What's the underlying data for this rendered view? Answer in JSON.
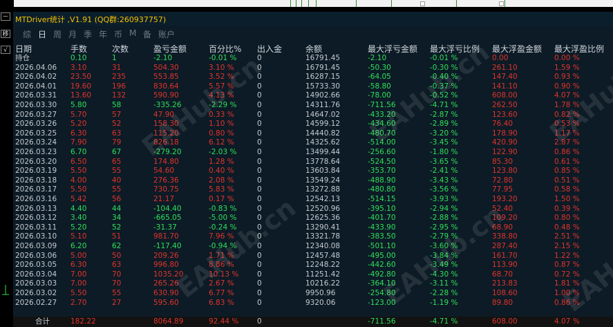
{
  "window_title": "MTDriver统计 ,V1.91 (QQ群:260937757)",
  "side_buttons": [
    "－",
    "移",
    "√"
  ],
  "tabs": [
    {
      "label": "综",
      "active": false
    },
    {
      "label": "日",
      "active": true
    },
    {
      "label": "周",
      "active": false
    },
    {
      "label": "月",
      "active": false
    },
    {
      "label": "季",
      "active": false
    },
    {
      "label": "年",
      "active": false
    },
    {
      "label": "币",
      "active": false
    },
    {
      "label": "M",
      "active": false
    },
    {
      "label": "备",
      "active": false
    },
    {
      "label": "账户",
      "active": false
    }
  ],
  "columns": [
    "日期",
    "手数",
    "次数",
    "盈亏金额",
    "百分比%",
    "出入金",
    "余额",
    "最大浮亏金额",
    "最大浮亏比例",
    "最大浮盈金额",
    "最大浮盈比例"
  ],
  "rows": [
    {
      "date": "持仓",
      "lots": "0.10",
      "count": "1",
      "pnl": "-2.10",
      "pct": "-0.01 %",
      "io": "0",
      "bal": "16791.45",
      "mfl": "-2.10",
      "mflp": "-0.01 %",
      "mfp": "0.00",
      "mfpp": "0.00 %",
      "color": "green"
    },
    {
      "date": "2026.04.06",
      "lots": "3.10",
      "count": "31",
      "pnl": "504.30",
      "pct": "3.10 %",
      "io": "0",
      "bal": "16791.45",
      "mfl": "-50.30",
      "mflp": "-0.30 %",
      "mfp": "261.10",
      "mfpp": "1.59 %",
      "color": "red"
    },
    {
      "date": "2026.04.02",
      "lots": "23.50",
      "count": "235",
      "pnl": "553.85",
      "pct": "3.52 %",
      "io": "0",
      "bal": "16287.15",
      "mfl": "-64.05",
      "mflp": "-0.40 %",
      "mfp": "147.40",
      "mfpp": "0.93 %",
      "color": "red"
    },
    {
      "date": "2026.04.01",
      "lots": "19.60",
      "count": "196",
      "pnl": "830.64",
      "pct": "5.57 %",
      "io": "0",
      "bal": "15733.30",
      "mfl": "-58.80",
      "mflp": "-0.37 %",
      "mfp": "141.10",
      "mfpp": "0.90 %",
      "color": "red"
    },
    {
      "date": "2026.03.31",
      "lots": "13.60",
      "count": "132",
      "pnl": "590.90",
      "pct": "4.13 %",
      "io": "0",
      "bal": "14902.66",
      "mfl": "-78.00",
      "mflp": "-0.52 %",
      "mfp": "608.00",
      "mfpp": "4.07 %",
      "color": "red"
    },
    {
      "date": "2026.03.30",
      "lots": "5.80",
      "count": "58",
      "pnl": "-335.26",
      "pct": "-2.29 %",
      "io": "0",
      "bal": "14311.76",
      "mfl": "-711.56",
      "mflp": "-4.71 %",
      "mfp": "262.50",
      "mfpp": "1.78 %",
      "color": "green"
    },
    {
      "date": "2026.03.27",
      "lots": "5.70",
      "count": "57",
      "pnl": "47.90",
      "pct": "0.33 %",
      "io": "0",
      "bal": "14647.02",
      "mfl": "-433.20",
      "mflp": "-2.87 %",
      "mfp": "123.60",
      "mfpp": "0.82 %",
      "color": "red"
    },
    {
      "date": "2026.03.26",
      "lots": "5.20",
      "count": "52",
      "pnl": "158.30",
      "pct": "1.10 %",
      "io": "0",
      "bal": "14599.12",
      "mfl": "-434.60",
      "mflp": "-2.89 %",
      "mfp": "76.40",
      "mfpp": "0.53 %",
      "color": "red"
    },
    {
      "date": "2026.03.25",
      "lots": "6.30",
      "count": "63",
      "pnl": "115.20",
      "pct": "0.80 %",
      "io": "0",
      "bal": "14440.82",
      "mfl": "-480.70",
      "mflp": "-3.20 %",
      "mfp": "178.90",
      "mfpp": "1.17 %",
      "color": "red"
    },
    {
      "date": "2026.03.24",
      "lots": "7.90",
      "count": "79",
      "pnl": "826.18",
      "pct": "6.12 %",
      "io": "0",
      "bal": "14325.62",
      "mfl": "-514.00",
      "mflp": "-3.45 %",
      "mfp": "420.90",
      "mfpp": "2.87 %",
      "color": "red"
    },
    {
      "date": "2026.03.23",
      "lots": "6.70",
      "count": "67",
      "pnl": "-279.20",
      "pct": "-2.03 %",
      "io": "0",
      "bal": "13499.44",
      "mfl": "-256.60",
      "mflp": "-1.80 %",
      "mfp": "122.90",
      "mfpp": "0.86 %",
      "color": "green"
    },
    {
      "date": "2026.03.20",
      "lots": "6.50",
      "count": "65",
      "pnl": "174.80",
      "pct": "1.28 %",
      "io": "0",
      "bal": "13778.64",
      "mfl": "-524.50",
      "mflp": "-3.65 %",
      "mfp": "85.30",
      "mfpp": "0.61 %",
      "color": "red"
    },
    {
      "date": "2026.03.19",
      "lots": "5.50",
      "count": "55",
      "pnl": "54.60",
      "pct": "0.40 %",
      "io": "0",
      "bal": "13603.84",
      "mfl": "-353.70",
      "mflp": "-2.41 %",
      "mfp": "123.80",
      "mfpp": "0.85 %",
      "color": "red"
    },
    {
      "date": "2026.03.18",
      "lots": "4.00",
      "count": "40",
      "pnl": "276.36",
      "pct": "2.08 %",
      "io": "0",
      "bal": "13549.24",
      "mfl": "-488.90",
      "mflp": "-3.43 %",
      "mfp": "72.80",
      "mfpp": "0.51 %",
      "color": "red"
    },
    {
      "date": "2026.03.17",
      "lots": "5.50",
      "count": "55",
      "pnl": "730.75",
      "pct": "5.83 %",
      "io": "0",
      "bal": "13272.88",
      "mfl": "-480.80",
      "mflp": "-3.56 %",
      "mfp": "77.95",
      "mfpp": "0.58 %",
      "color": "red"
    },
    {
      "date": "2026.03.16",
      "lots": "5.42",
      "count": "56",
      "pnl": "21.17",
      "pct": "0.17 %",
      "io": "0",
      "bal": "12542.13",
      "mfl": "-514.15",
      "mflp": "-3.93 %",
      "mfp": "193.20",
      "mfpp": "1.50 %",
      "color": "red"
    },
    {
      "date": "2026.03.13",
      "lots": "4.40",
      "count": "44",
      "pnl": "-104.40",
      "pct": "-0.83 %",
      "io": "0",
      "bal": "12520.96",
      "mfl": "-395.10",
      "mflp": "-2.94 %",
      "mfp": "52.40",
      "mfpp": "0.39 %",
      "color": "green"
    },
    {
      "date": "2026.03.12",
      "lots": "3.40",
      "count": "34",
      "pnl": "-665.05",
      "pct": "-5.00 %",
      "io": "0",
      "bal": "12625.36",
      "mfl": "-401.70",
      "mflp": "-2.88 %",
      "mfp": "109.20",
      "mfpp": "0.80 %",
      "color": "green"
    },
    {
      "date": "2026.03.11",
      "lots": "5.20",
      "count": "52",
      "pnl": "-31.37",
      "pct": "-0.24 %",
      "io": "0",
      "bal": "13290.41",
      "mfl": "-433.90",
      "mflp": "-2.95 %",
      "mfp": "68.90",
      "mfpp": "0.48 %",
      "color": "green"
    },
    {
      "date": "2026.03.10",
      "lots": "5.10",
      "count": "51",
      "pnl": "981.70",
      "pct": "7.96 %",
      "io": "0",
      "bal": "13321.78",
      "mfl": "-383.50",
      "mflp": "-2.79 %",
      "mfp": "338.80",
      "mfpp": "2.51 %",
      "color": "red"
    },
    {
      "date": "2026.03.09",
      "lots": "6.20",
      "count": "62",
      "pnl": "-117.40",
      "pct": "-0.94 %",
      "io": "0",
      "bal": "12340.08",
      "mfl": "-501.10",
      "mflp": "-3.60 %",
      "mfp": "287.40",
      "mfpp": "2.15 %",
      "color": "green"
    },
    {
      "date": "2026.03.06",
      "lots": "5.00",
      "count": "50",
      "pnl": "209.26",
      "pct": "1.71 %",
      "io": "0",
      "bal": "12457.48",
      "mfl": "-495.00",
      "mflp": "-3.84 %",
      "mfp": "161.70",
      "mfpp": "1.22 %",
      "color": "red"
    },
    {
      "date": "2026.03.05",
      "lots": "6.30",
      "count": "63",
      "pnl": "996.80",
      "pct": "8.86 %",
      "io": "0",
      "bal": "12248.22",
      "mfl": "-442.60",
      "mflp": "-3.49 %",
      "mfp": "113.90",
      "mfpp": "0.87 %",
      "color": "red"
    },
    {
      "date": "2026.03.04",
      "lots": "7.00",
      "count": "70",
      "pnl": "1035.20",
      "pct": "10.13 %",
      "io": "0",
      "bal": "11251.42",
      "mfl": "-492.80",
      "mflp": "-4.30 %",
      "mfp": "68.70",
      "mfpp": "0.72 %",
      "color": "red"
    },
    {
      "date": "2026.03.03",
      "lots": "7.00",
      "count": "70",
      "pnl": "265.26",
      "pct": "2.67 %",
      "io": "0",
      "bal": "10216.22",
      "mfl": "-364.10",
      "mflp": "-3.11 %",
      "mfp": "213.83",
      "mfpp": "1.81 %",
      "color": "red"
    },
    {
      "date": "2026.03.02",
      "lots": "5.50",
      "count": "55",
      "pnl": "630.90",
      "pct": "6.77 %",
      "io": "0",
      "bal": "9950.96",
      "mfl": "-254.80",
      "mflp": "-2.28 %",
      "mfp": "108.60",
      "mfpp": "1.00 %",
      "color": "red"
    },
    {
      "date": "2026.02.27",
      "lots": "2.70",
      "count": "27",
      "pnl": "595.60",
      "pct": "6.83 %",
      "io": "0",
      "bal": "9320.06",
      "mfl": "-123.00",
      "mflp": "-1.19 %",
      "mfp": "89.80",
      "mfpp": "0.86 %",
      "color": "red"
    }
  ],
  "total": {
    "label": "合计",
    "lots": "182.22",
    "count": "",
    "pnl": "8064.89",
    "pct": "92.44 %",
    "io": "0",
    "bal": "",
    "mfl": "-711.56",
    "mflp": "-4.71 %",
    "mfp": "608.00",
    "mfpp": "4.07 %"
  },
  "watermark": "EAHub.cn",
  "colors": {
    "profit": "#e0342c",
    "loss": "#2ee05a",
    "title": "#f5c300",
    "panel": "#0d1b26"
  }
}
